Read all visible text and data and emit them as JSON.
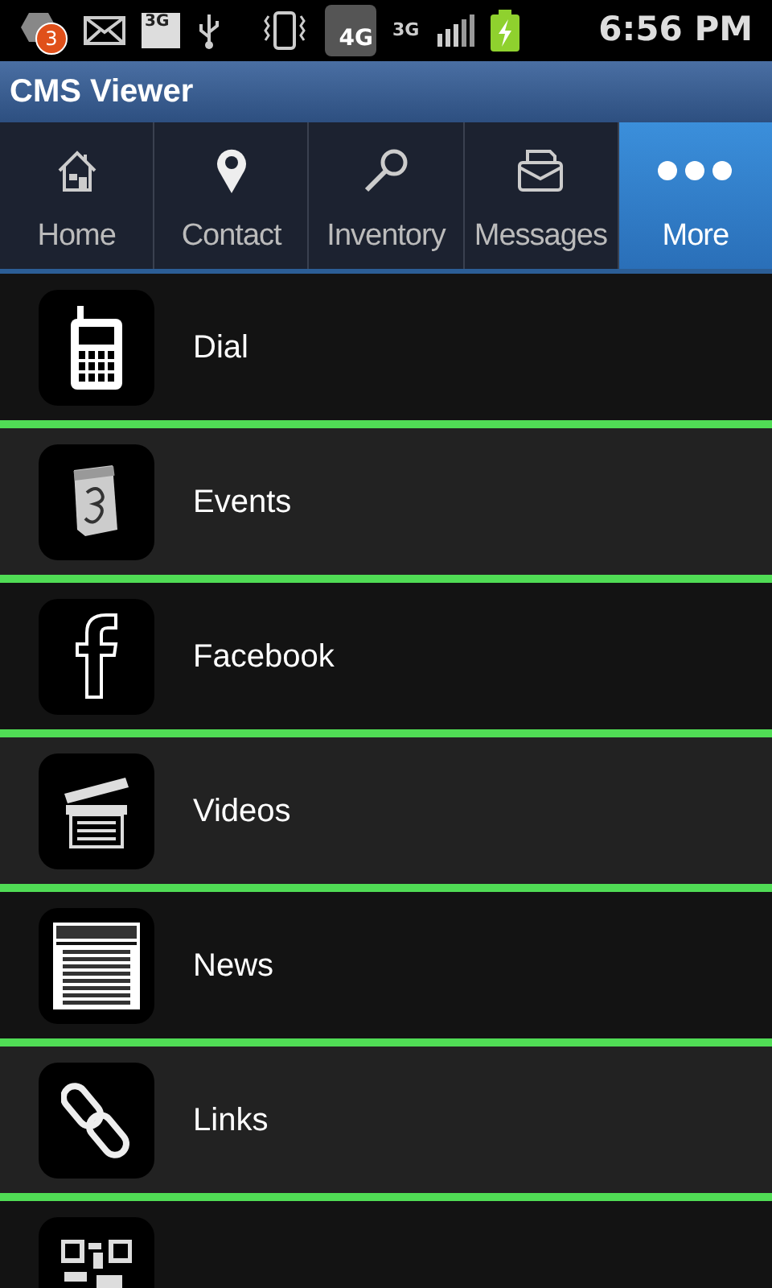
{
  "status_bar": {
    "notification_count": "3",
    "data_label": "3G",
    "network_label": "4G",
    "signal_label": "3G",
    "time": "6:56 PM"
  },
  "window": {
    "title": "CMS Viewer"
  },
  "tabs": [
    {
      "label": "Home",
      "kind": "home",
      "selected": false
    },
    {
      "label": "Contact",
      "kind": "pin",
      "selected": false
    },
    {
      "label": "Inventory",
      "kind": "search",
      "selected": false
    },
    {
      "label": "Messages",
      "kind": "mail",
      "selected": false
    },
    {
      "label": "More",
      "kind": "more",
      "selected": true
    }
  ],
  "items": [
    {
      "label": "Dial",
      "kind": "phone"
    },
    {
      "label": "Events",
      "kind": "calendar"
    },
    {
      "label": "Facebook",
      "kind": "facebook"
    },
    {
      "label": "Videos",
      "kind": "clapper"
    },
    {
      "label": "News",
      "kind": "news"
    },
    {
      "label": "Links",
      "kind": "link"
    },
    {
      "kind": "qr"
    }
  ]
}
